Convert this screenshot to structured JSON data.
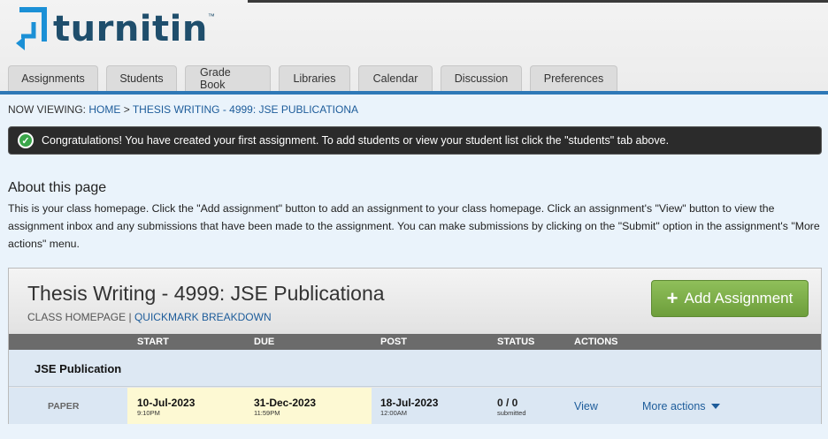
{
  "brand": {
    "name": "turnitin",
    "tm": "™",
    "color": "#1f4e6c",
    "icon": "turnitin-logo-icon"
  },
  "tabs": [
    {
      "label": "Assignments"
    },
    {
      "label": "Students"
    },
    {
      "label": "Grade Book"
    },
    {
      "label": "Libraries"
    },
    {
      "label": "Calendar"
    },
    {
      "label": "Discussion"
    },
    {
      "label": "Preferences"
    }
  ],
  "breadcrumb": {
    "prefix": "NOW VIEWING:",
    "home": "HOME",
    "separator": ">",
    "current": "THESIS WRITING - 4999: JSE PUBLICATIONA"
  },
  "alert": {
    "icon": "check-circle-icon",
    "message": "Congratulations! You have created your first assignment. To add students or view your student list click the \"students\" tab above."
  },
  "about": {
    "title": "About this page",
    "body": "This is your class homepage. Click the \"Add assignment\" button to add an assignment to your class homepage. Click an assignment's \"View\" button to view the assignment inbox and any submissions that have been made to the assignment. You can make submissions by clicking on the \"Submit\" option in the assignment's \"More actions\" menu."
  },
  "class": {
    "title": "Thesis Writing - 4999: JSE Publicationa",
    "homepage_label": "CLASS HOMEPAGE",
    "divider": "|",
    "quickmark_label": "QUICKMARK BREAKDOWN",
    "add_button": "Add Assignment",
    "add_button_color": "#7aad45"
  },
  "columns": {
    "start": "START",
    "due": "DUE",
    "post": "POST",
    "status": "STATUS",
    "actions": "ACTIONS"
  },
  "assignment_group": {
    "title": "JSE Publication"
  },
  "assignment": {
    "type": "PAPER",
    "start_date": "10-Jul-2023",
    "start_time": "9:10PM",
    "due_date": "31-Dec-2023",
    "due_time": "11:59PM",
    "post_date": "18-Jul-2023",
    "post_time": "12:00AM",
    "status": "0 / 0",
    "status_sub": "submitted",
    "view_label": "View",
    "more_label": "More actions"
  }
}
